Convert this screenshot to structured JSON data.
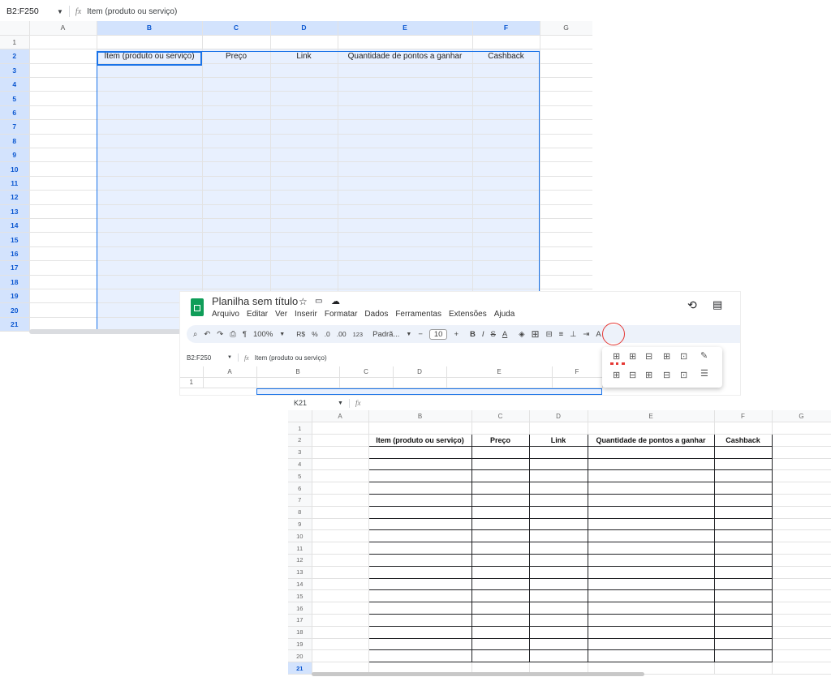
{
  "shot1": {
    "name_box": "B2:F250",
    "formula": "Item (produto ou serviço)",
    "columns": [
      "A",
      "B",
      "C",
      "D",
      "E",
      "F",
      "G"
    ],
    "rows": [
      "1",
      "2",
      "3",
      "4",
      "5",
      "6",
      "7",
      "8",
      "9",
      "10",
      "11",
      "12",
      "13",
      "14",
      "15",
      "16",
      "17",
      "18",
      "19",
      "20",
      "21"
    ],
    "header_values": [
      "Item (produto ou serviço)",
      "Preço",
      "Link",
      "Quantidade de pontos a ganhar",
      "Cashback"
    ]
  },
  "shot2": {
    "title": "Planilha sem título",
    "menu": [
      "Arquivo",
      "Editar",
      "Ver",
      "Inserir",
      "Formatar",
      "Dados",
      "Ferramentas",
      "Extensões",
      "Ajuda"
    ],
    "toolbar": {
      "zoom": "100%",
      "currency": "R$",
      "percent": "%",
      "dec_decrease": ".0",
      "dec_increase": ".00",
      "number_format": "123",
      "font": "Padrã...",
      "font_size": "10",
      "bold": "B",
      "italic": "I",
      "strike": "S",
      "text_color": "A"
    },
    "name_box": "B2:F250",
    "formula": "Item (produto ou serviço)",
    "columns": [
      "A",
      "B",
      "C",
      "D",
      "E",
      "F"
    ],
    "rows": [
      "1"
    ]
  },
  "shot3": {
    "name_box": "K21",
    "formula": "",
    "columns": [
      "A",
      "B",
      "C",
      "D",
      "E",
      "F",
      "G"
    ],
    "rows": [
      "1",
      "2",
      "3",
      "4",
      "5",
      "6",
      "7",
      "8",
      "9",
      "10",
      "11",
      "12",
      "13",
      "14",
      "15",
      "16",
      "17",
      "18",
      "19",
      "20",
      "21"
    ],
    "header_values": [
      "Item (produto ou serviço)",
      "Preço",
      "Link",
      "Quantidade de pontos a ganhar",
      "Cashback"
    ]
  },
  "colors": {
    "selection_fill": "#e8f0fe",
    "selection_border": "#1a73e8",
    "header_selected": "#d3e3fd",
    "highlight_circle": "#e53935",
    "sheets_green": "#0f9d58"
  },
  "icons": [
    "dropdown-icon",
    "fx-icon",
    "sheets-logo-icon",
    "star-icon",
    "folder-icon",
    "cloud-icon",
    "history-icon",
    "comment-icon",
    "search-icon",
    "undo-icon",
    "redo-icon",
    "print-icon",
    "paint-format-icon",
    "fill-color-icon",
    "borders-icon",
    "merge-icon",
    "align-icon",
    "valign-icon",
    "wrap-icon",
    "rotate-icon",
    "all-borders-icon",
    "pencil-icon",
    "border-style-icon"
  ]
}
